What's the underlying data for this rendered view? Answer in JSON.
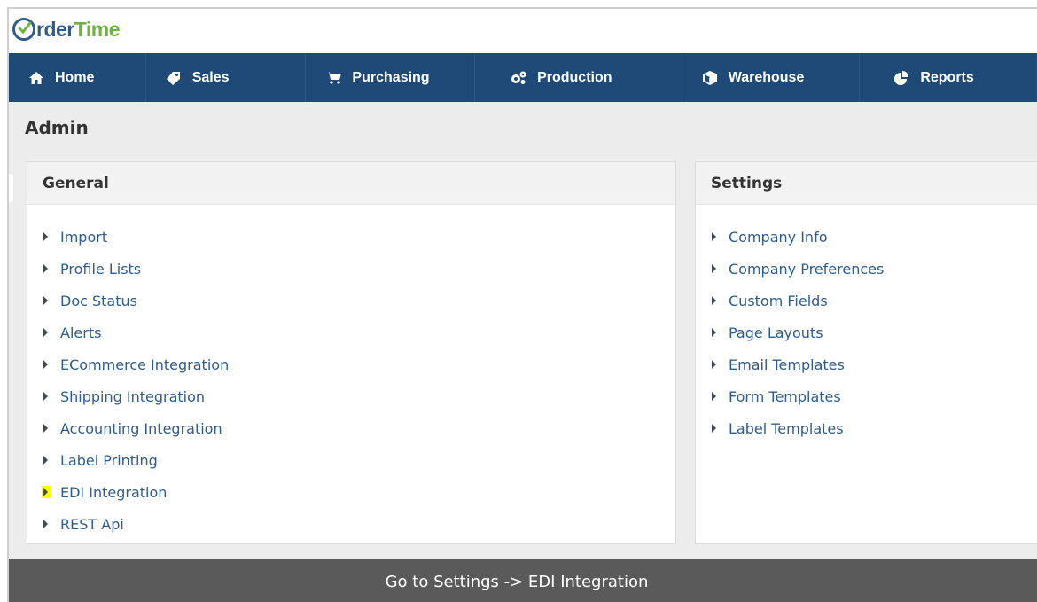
{
  "logo": {
    "part1": "rder",
    "part2": "Time"
  },
  "nav": {
    "items": [
      {
        "label": "Home",
        "icon": "home-icon"
      },
      {
        "label": "Sales",
        "icon": "tag-icon"
      },
      {
        "label": "Purchasing",
        "icon": "cart-icon"
      },
      {
        "label": "Production",
        "icon": "gears-icon"
      },
      {
        "label": "Warehouse",
        "icon": "box-icon"
      },
      {
        "label": "Reports",
        "icon": "pie-chart-icon"
      }
    ]
  },
  "page": {
    "title": "Admin"
  },
  "general": {
    "title": "General",
    "items": [
      "Import",
      "Profile Lists",
      "Doc Status",
      "Alerts",
      "ECommerce Integration",
      "Shipping Integration",
      "Accounting Integration",
      "Label Printing",
      "EDI Integration",
      "REST Api"
    ]
  },
  "settings": {
    "title": "Settings",
    "items": [
      "Company Info",
      "Company Preferences",
      "Custom Fields",
      "Page Layouts",
      "Email Templates",
      "Form Templates",
      "Label Templates"
    ]
  },
  "caption": "Go to Settings -> EDI Integration",
  "colors": {
    "nav_bg": "#1f4a78",
    "link": "#2f5c8a",
    "logo_blue": "#2f5c8a",
    "logo_green": "#6cb33f",
    "highlight": "#ffff00",
    "caption_bg": "#5a5a5a"
  }
}
